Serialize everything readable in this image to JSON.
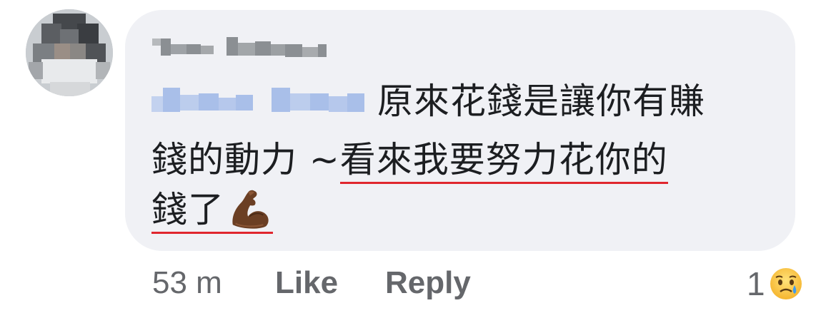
{
  "comment": {
    "text_line1": "原來花錢是讓你有賺",
    "text_line2_plain": "錢的動力 ~",
    "text_line2_underlined": "看來我要努力花你的",
    "text_line3_underlined": "錢了",
    "emoji": "flexed-biceps-emoji",
    "underline_color": "#e0262e",
    "bubble_color": "#f0f1f5"
  },
  "actions": {
    "timestamp": "53 m",
    "like_label": "Like",
    "reply_label": "Reply"
  },
  "reactions": {
    "count": "1",
    "icon": "sad-crying-face-icon"
  }
}
